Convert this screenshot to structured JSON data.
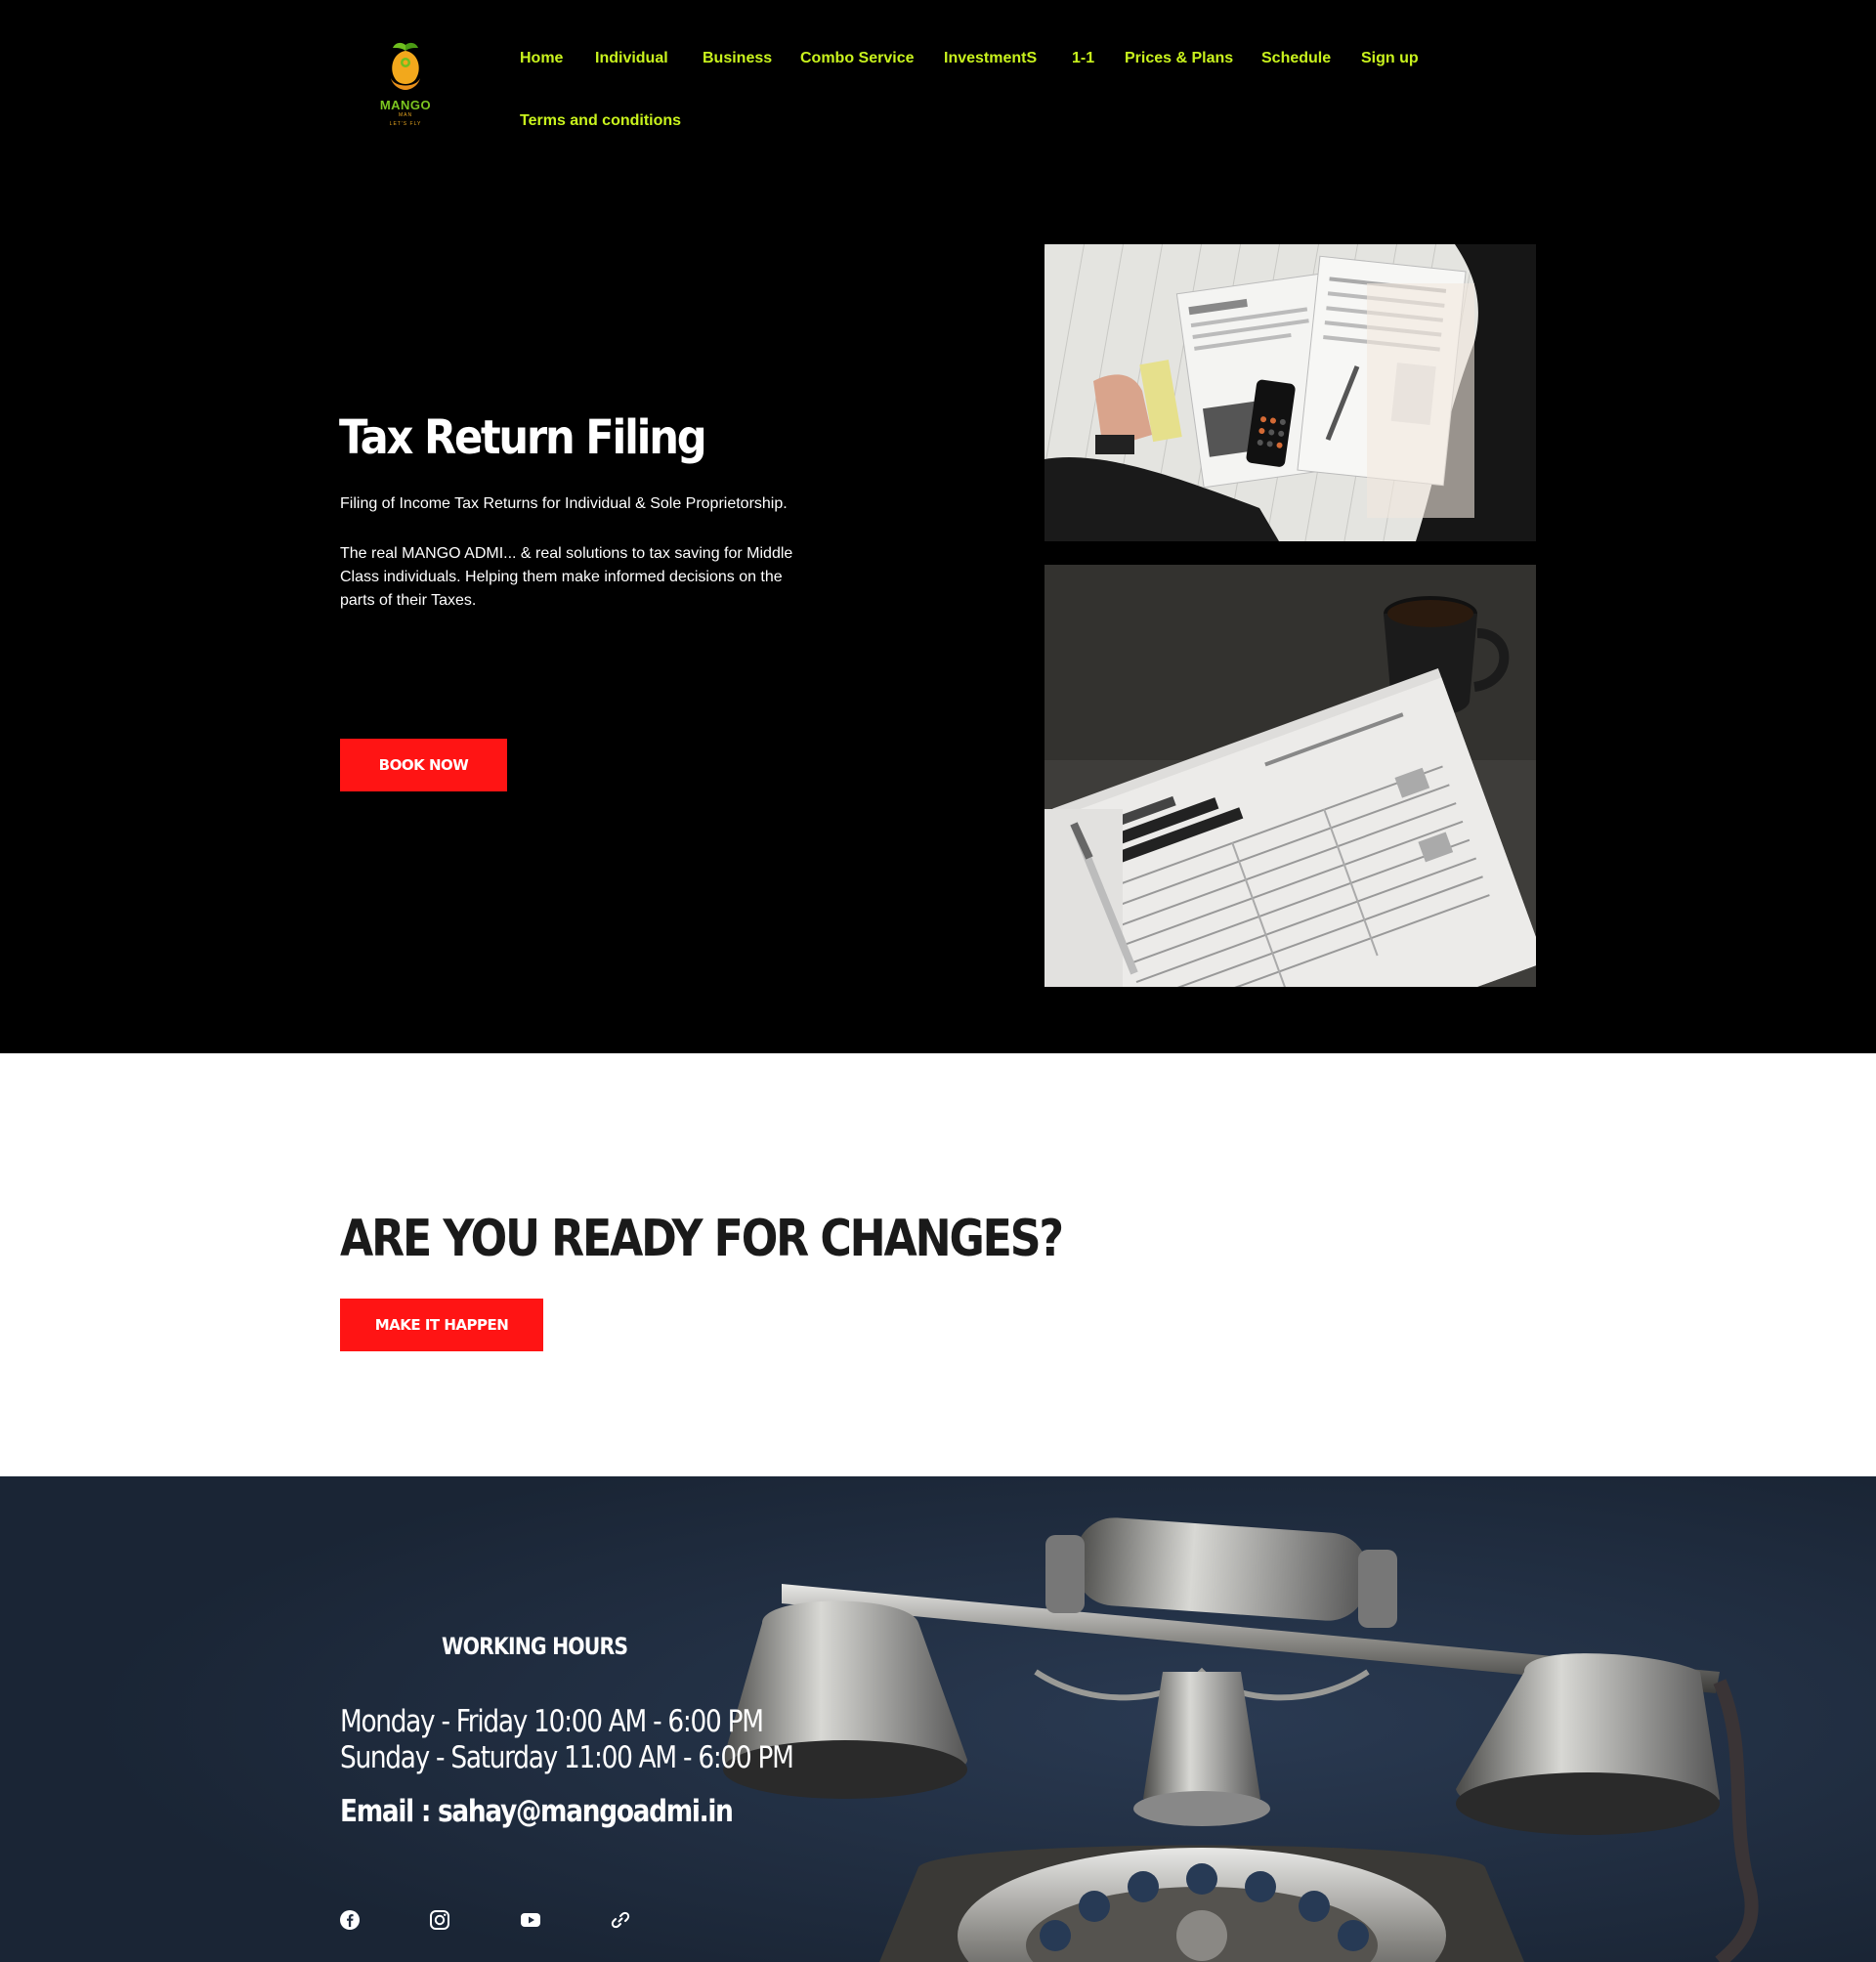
{
  "brand": {
    "name": "MANGO",
    "tagline_line1": "MAN",
    "tagline_line2": "LET'S FLY"
  },
  "nav": {
    "items": [
      {
        "label": "Home"
      },
      {
        "label": "Individual"
      },
      {
        "label": "Business"
      },
      {
        "label": "Combo Service"
      },
      {
        "label": "InvestmentS"
      },
      {
        "label": "1-1"
      },
      {
        "label": "Prices & Plans"
      },
      {
        "label": "Schedule"
      },
      {
        "label": "Sign up"
      },
      {
        "label": "Terms and conditions"
      }
    ]
  },
  "hero": {
    "title": "Tax Return Filing",
    "subtitle": "Filing of Income Tax Returns for Individual & Sole Proprietorship.",
    "description": "The real MANGO ADMI... & real solutions to tax saving for Middle Class individuals. Helping them make informed decisions on the parts of their Taxes.",
    "cta": "BOOK NOW"
  },
  "cta_band": {
    "title": "ARE YOU READY FOR CHANGES?",
    "button": "MAKE IT HAPPEN"
  },
  "contact": {
    "title": "WORKING HOURS",
    "hours": [
      "Monday - Friday 10:00 AM - 6:00 PM",
      "Sunday - Saturday 11:00 AM - 6:00 PM"
    ],
    "email": "Email : sahay@mangoadmi.in",
    "social": [
      "facebook-icon",
      "instagram-icon",
      "youtube-icon",
      "link-icon"
    ]
  },
  "colors": {
    "nav_text": "#c9f31d",
    "accent_red": "#ff1414",
    "header_bg": "#000000",
    "contact_bg": "#1e2a3d"
  }
}
